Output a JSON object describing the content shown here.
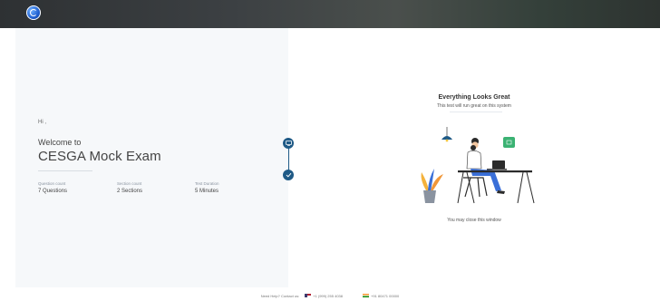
{
  "header": {
    "logo_icon": "org-logo-icon"
  },
  "welcome": {
    "greeting": "Hi ,",
    "welcome_text": "Welcome to",
    "exam_title": "CESGA Mock Exam"
  },
  "stats": [
    {
      "label": "Question count",
      "value": "7 Questions"
    },
    {
      "label": "Section count",
      "value": "2 Sections"
    },
    {
      "label": "Test Duration",
      "value": "5 Minutes"
    }
  ],
  "stepper": [
    {
      "icon": "system-check-icon",
      "state": "active"
    },
    {
      "icon": "check-icon",
      "state": "done"
    }
  ],
  "result": {
    "title": "Everything Looks Great",
    "subtitle": "This test will run great on this system",
    "close_note": "You may close this window",
    "illustration": "person-at-desk-illustration"
  },
  "footer": {
    "help_text": "Need Help? Contact us:",
    "phone_us": "+1 (999) 255 4038",
    "phone_in": "+91 80471 00000"
  },
  "colors": {
    "accent": "#1f5a86",
    "success": "#3bb273",
    "left_panel_bg": "#f6f8fa"
  }
}
